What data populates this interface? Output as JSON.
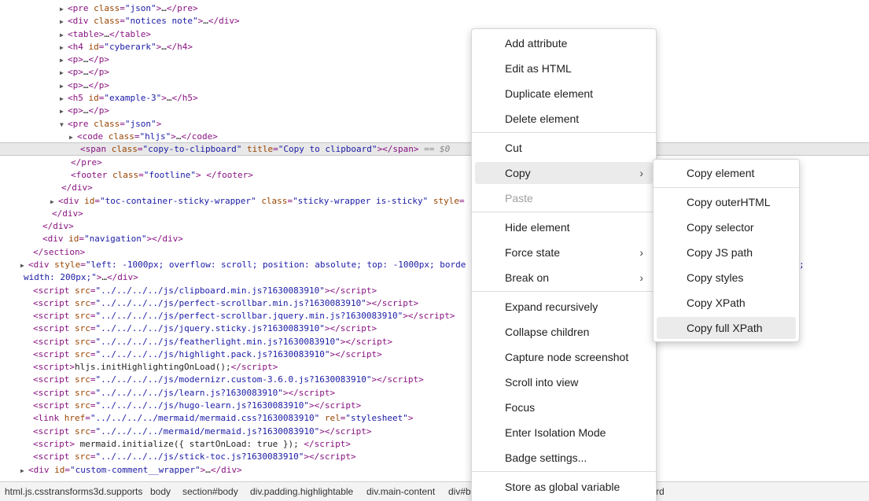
{
  "dom_lines": [
    {
      "arrow": "right",
      "indent": 86,
      "html": "<span class=\"tag\">&lt;pre</span> <span class=\"attr\">class</span>=<span class=\"val\">\"json\"</span><span class=\"tag\">&gt;</span><span class=\"txt\">…</span><span class=\"tag\">&lt;/pre&gt;</span>"
    },
    {
      "arrow": "right",
      "indent": 86,
      "html": "<span class=\"tag\">&lt;div</span> <span class=\"attr\">class</span>=<span class=\"val\">\"notices note\"</span><span class=\"tag\">&gt;</span><span class=\"txt\">…</span><span class=\"tag\">&lt;/div&gt;</span>"
    },
    {
      "arrow": "right",
      "indent": 86,
      "html": "<span class=\"tag\">&lt;table&gt;</span><span class=\"txt\">…</span><span class=\"tag\">&lt;/table&gt;</span>"
    },
    {
      "arrow": "right",
      "indent": 86,
      "html": "<span class=\"tag\">&lt;h4</span> <span class=\"attr\">id</span>=<span class=\"val\">\"cyberark\"</span><span class=\"tag\">&gt;</span><span class=\"txt\">…</span><span class=\"tag\">&lt;/h4&gt;</span>"
    },
    {
      "arrow": "right",
      "indent": 86,
      "html": "<span class=\"tag\">&lt;p&gt;</span><span class=\"txt\">…</span><span class=\"tag\">&lt;/p&gt;</span>"
    },
    {
      "arrow": "right",
      "indent": 86,
      "html": "<span class=\"tag\">&lt;p&gt;</span><span class=\"txt\">…</span><span class=\"tag\">&lt;/p&gt;</span>"
    },
    {
      "arrow": "right",
      "indent": 86,
      "html": "<span class=\"tag\">&lt;p&gt;</span><span class=\"txt\">…</span><span class=\"tag\">&lt;/p&gt;</span>"
    },
    {
      "arrow": "right",
      "indent": 86,
      "html": "<span class=\"tag\">&lt;h5</span> <span class=\"attr\">id</span>=<span class=\"val\">\"example-3\"</span><span class=\"tag\">&gt;</span><span class=\"txt\">…</span><span class=\"tag\">&lt;/h5&gt;</span>"
    },
    {
      "arrow": "right",
      "indent": 86,
      "html": "<span class=\"tag\">&lt;p&gt;</span><span class=\"txt\">…</span><span class=\"tag\">&lt;/p&gt;</span>"
    },
    {
      "arrow": "down",
      "indent": 86,
      "html": "<span class=\"tag\">&lt;pre</span> <span class=\"attr\">class</span>=<span class=\"val\">\"json\"</span><span class=\"tag\">&gt;</span>"
    },
    {
      "arrow": "right",
      "indent": 98,
      "html": "<span class=\"tag\">&lt;code</span> <span class=\"attr\">class</span>=<span class=\"val\">\"hljs\"</span><span class=\"tag\">&gt;</span><span class=\"txt\">…</span><span class=\"tag\">&lt;/code&gt;</span>"
    },
    {
      "arrow": "none",
      "indent": 102,
      "selected": true,
      "html": "<span class=\"tag\">&lt;span</span> <span class=\"attr\">class</span>=<span class=\"val\">\"copy-to-clipboard\"</span> <span class=\"attr\">title</span>=<span class=\"val\">\"Copy to clipboard\"</span><span class=\"tag\">&gt;&lt;/span&gt;</span> <span class=\"dollar\">== $0</span>"
    },
    {
      "arrow": "none",
      "indent": 90,
      "html": "<span class=\"tag\">&lt;/pre&gt;</span>"
    },
    {
      "arrow": "none",
      "indent": 90,
      "html": "<span class=\"tag\">&lt;footer</span> <span class=\"attr\">class</span>=<span class=\"val\">\"footline\"</span><span class=\"tag\">&gt; &lt;/footer&gt;</span>"
    },
    {
      "arrow": "none",
      "indent": 78,
      "html": "<span class=\"tag\">&lt;/div&gt;</span>"
    },
    {
      "arrow": "right",
      "indent": 74,
      "html": "<span class=\"tag\">&lt;div</span> <span class=\"attr\">id</span>=<span class=\"val\">\"toc-container-sticky-wrapper\"</span> <span class=\"attr\">class</span>=<span class=\"val\">\"sticky-wrapper is-sticky\"</span> <span class=\"attr\">style</span>="
    },
    {
      "arrow": "none",
      "indent": 66,
      "html": "<span class=\"tag\">&lt;/div&gt;</span>"
    },
    {
      "arrow": "none",
      "indent": 54,
      "html": "<span class=\"tag\">&lt;/div&gt;</span>"
    },
    {
      "arrow": "none",
      "indent": 54,
      "html": "<span class=\"tag\">&lt;div</span> <span class=\"attr\">id</span>=<span class=\"val\">\"navigation\"</span><span class=\"tag\">&gt;&lt;/div&gt;</span>"
    },
    {
      "arrow": "none",
      "indent": 42,
      "html": "<span class=\"tag\">&lt;/section&gt;</span>"
    },
    {
      "arrow": "right",
      "indent": 36,
      "html": "<span class=\"tag\">&lt;div</span> <span class=\"attr\">style</span>=<span class=\"val\">\"left: -1000px; overflow: scroll; position: absolute; top: -1000px; borde</span>                                                     <span class=\"val\">adding: 0px;</span>"
    },
    {
      "arrow": "none",
      "indent": 30,
      "html": "<span class=\"val\">width: 200px;\"</span><span class=\"tag\">&gt;</span><span class=\"txt\">…</span><span class=\"tag\">&lt;/div&gt;</span>"
    },
    {
      "arrow": "none",
      "indent": 42,
      "html": "<span class=\"tag\">&lt;script</span> <span class=\"attr\">src</span>=<span class=\"val\">\"../../../../js/clipboard.min.js?1630083910\"</span><span class=\"tag\">&gt;&lt;/script&gt;</span>"
    },
    {
      "arrow": "none",
      "indent": 42,
      "html": "<span class=\"tag\">&lt;script</span> <span class=\"attr\">src</span>=<span class=\"val\">\"../../../../js/perfect-scrollbar.min.js?1630083910\"</span><span class=\"tag\">&gt;&lt;/script&gt;</span>"
    },
    {
      "arrow": "none",
      "indent": 42,
      "html": "<span class=\"tag\">&lt;script</span> <span class=\"attr\">src</span>=<span class=\"val\">\"../../../../js/perfect-scrollbar.jquery.min.js?1630083910\"</span><span class=\"tag\">&gt;&lt;/script&gt;</span>"
    },
    {
      "arrow": "none",
      "indent": 42,
      "html": "<span class=\"tag\">&lt;script</span> <span class=\"attr\">src</span>=<span class=\"val\">\"../../../../js/jquery.sticky.js?1630083910\"</span><span class=\"tag\">&gt;&lt;/script&gt;</span>"
    },
    {
      "arrow": "none",
      "indent": 42,
      "html": "<span class=\"tag\">&lt;script</span> <span class=\"attr\">src</span>=<span class=\"val\">\"../../../../js/featherlight.min.js?1630083910\"</span><span class=\"tag\">&gt;&lt;/script&gt;</span>"
    },
    {
      "arrow": "none",
      "indent": 42,
      "html": "<span class=\"tag\">&lt;script</span> <span class=\"attr\">src</span>=<span class=\"val\">\"../../../../js/highlight.pack.js?1630083910\"</span><span class=\"tag\">&gt;&lt;/script&gt;</span>"
    },
    {
      "arrow": "none",
      "indent": 42,
      "html": "<span class=\"tag\">&lt;script&gt;</span><span class=\"txt\">hljs.initHighlightingOnLoad();</span><span class=\"tag\">&lt;/script&gt;</span>"
    },
    {
      "arrow": "none",
      "indent": 42,
      "html": "<span class=\"tag\">&lt;script</span> <span class=\"attr\">src</span>=<span class=\"val\">\"../../../../js/modernizr.custom-3.6.0.js?1630083910\"</span><span class=\"tag\">&gt;&lt;/script&gt;</span>"
    },
    {
      "arrow": "none",
      "indent": 42,
      "html": "<span class=\"tag\">&lt;script</span> <span class=\"attr\">src</span>=<span class=\"val\">\"../../../../js/learn.js?1630083910\"</span><span class=\"tag\">&gt;&lt;/script&gt;</span>"
    },
    {
      "arrow": "none",
      "indent": 42,
      "html": "<span class=\"tag\">&lt;script</span> <span class=\"attr\">src</span>=<span class=\"val\">\"../../../../js/hugo-learn.js?1630083910\"</span><span class=\"tag\">&gt;&lt;/script&gt;</span>"
    },
    {
      "arrow": "none",
      "indent": 42,
      "html": "<span class=\"tag\">&lt;link</span> <span class=\"attr\">href</span>=<span class=\"val\">\"../../../../mermaid/mermaid.css?1630083910\"</span> <span class=\"attr\">rel</span>=<span class=\"val\">\"stylesheet\"</span><span class=\"tag\">&gt;</span>"
    },
    {
      "arrow": "none",
      "indent": 42,
      "html": "<span class=\"tag\">&lt;script</span> <span class=\"attr\">src</span>=<span class=\"val\">\"../../../../mermaid/mermaid.js?1630083910\"</span><span class=\"tag\">&gt;&lt;/script&gt;</span>"
    },
    {
      "arrow": "none",
      "indent": 42,
      "html": "<span class=\"tag\">&lt;script&gt;</span><span class=\"txt\"> mermaid.initialize({ startOnLoad: true }); </span><span class=\"tag\">&lt;/script&gt;</span>"
    },
    {
      "arrow": "none",
      "indent": 42,
      "html": "<span class=\"tag\">&lt;script</span> <span class=\"attr\">src</span>=<span class=\"val\">\"../../../../js/stick-toc.js?1630083910\"</span><span class=\"tag\">&gt;&lt;/script&gt;</span>"
    },
    {
      "arrow": "right",
      "indent": 36,
      "html": "<span class=\"tag\">&lt;div</span> <span class=\"attr\">id</span>=<span class=\"val\">\"custom-comment__wrapper\"</span><span class=\"tag\">&gt;</span><span class=\"txt\">…</span><span class=\"tag\">&lt;/div&gt;</span>"
    }
  ],
  "breadcrumb": {
    "items": [
      "html.js.csstransforms3d.supports",
      "body",
      "section#body",
      "div.padding.highlightable",
      "div.main-content",
      "div#b",
      "rd"
    ]
  },
  "context_menu": {
    "items": [
      {
        "label": "Add attribute"
      },
      {
        "label": "Edit as HTML"
      },
      {
        "label": "Duplicate element"
      },
      {
        "label": "Delete element"
      },
      {
        "label": "Cut"
      },
      {
        "label": "Copy",
        "submenu": true,
        "active": true
      },
      {
        "label": "Paste",
        "disabled": true
      },
      {
        "label": "Hide element"
      },
      {
        "label": "Force state",
        "submenu": true
      },
      {
        "label": "Break on",
        "submenu": true
      },
      {
        "label": "Expand recursively"
      },
      {
        "label": "Collapse children"
      },
      {
        "label": "Capture node screenshot"
      },
      {
        "label": "Scroll into view"
      },
      {
        "label": "Focus"
      },
      {
        "label": "Enter Isolation Mode"
      },
      {
        "label": "Badge settings..."
      },
      {
        "label": "Store as global variable"
      }
    ]
  },
  "copy_submenu": {
    "items": [
      {
        "label": "Copy element"
      },
      {
        "label": "Copy outerHTML"
      },
      {
        "label": "Copy selector"
      },
      {
        "label": "Copy JS path"
      },
      {
        "label": "Copy styles"
      },
      {
        "label": "Copy XPath"
      },
      {
        "label": "Copy full XPath",
        "active": true
      }
    ]
  },
  "colors": {
    "tag": "#881280",
    "attribute": "#994500",
    "value": "#1a1aa6",
    "selected_row": "#e8e8e8",
    "menu_hover": "#ebebeb",
    "disabled": "#a0a0a0"
  },
  "icons": {
    "expand": "triangle-right-icon",
    "collapse": "triangle-down-icon",
    "submenu": "chevron-right-icon"
  }
}
